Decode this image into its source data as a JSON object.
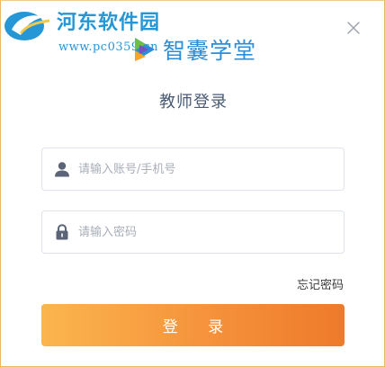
{
  "watermark": {
    "site_name": "河东软件园",
    "site_url": "www.pc0359.cn"
  },
  "brand": {
    "app_name": "智囊学堂",
    "mark_icon": "play-logo-icon",
    "color": "#2b8ed6"
  },
  "dialog": {
    "title": "教师登录",
    "close_icon": "close-icon"
  },
  "form": {
    "account": {
      "placeholder": "请输入账号/手机号",
      "value": "",
      "icon": "user-icon"
    },
    "password": {
      "placeholder": "请输入密码",
      "value": "",
      "icon": "lock-icon"
    },
    "forgot_label": "忘记密码",
    "submit_label": "登 录"
  },
  "colors": {
    "accent_start": "#fbb54e",
    "accent_end": "#ee7a2a",
    "border": "#e9b865",
    "title_text": "#4a5a73",
    "watermark": "#2596d6"
  }
}
